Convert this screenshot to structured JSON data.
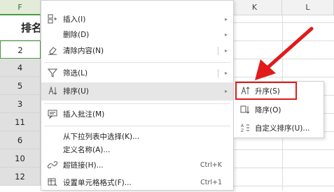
{
  "columns": {
    "f": "F",
    "k": "K",
    "l": "L"
  },
  "f_header": "排名",
  "f_rows": [
    "2",
    "4",
    "5",
    "3",
    "11",
    "6",
    "10",
    "12"
  ],
  "menu": {
    "items": [
      {
        "label": "插入(I)",
        "has_submenu": true
      },
      {
        "label": "删除(D)",
        "has_submenu": true
      },
      {
        "label": "清除内容(N)",
        "has_submenu": true
      },
      {
        "label": "筛选(L)",
        "has_submenu": true
      },
      {
        "label": "排序(U)",
        "has_submenu": true
      },
      {
        "label": "插入批注(M)"
      },
      {
        "label": "从下拉列表中选择(K)..."
      },
      {
        "label": "定义名称(A)..."
      },
      {
        "label": "超链接(H)...",
        "shortcut": "Ctrl+K"
      },
      {
        "label": "设置单元格格式(F)...",
        "shortcut": "Ctrl+1"
      }
    ]
  },
  "submenu": {
    "items": [
      {
        "label": "升序(S)"
      },
      {
        "label": "降序(O)"
      },
      {
        "label": "自定义排序(U)..."
      }
    ]
  },
  "colors": {
    "highlight_red": "#e21a1a",
    "selection_green": "#4a9a3e"
  }
}
